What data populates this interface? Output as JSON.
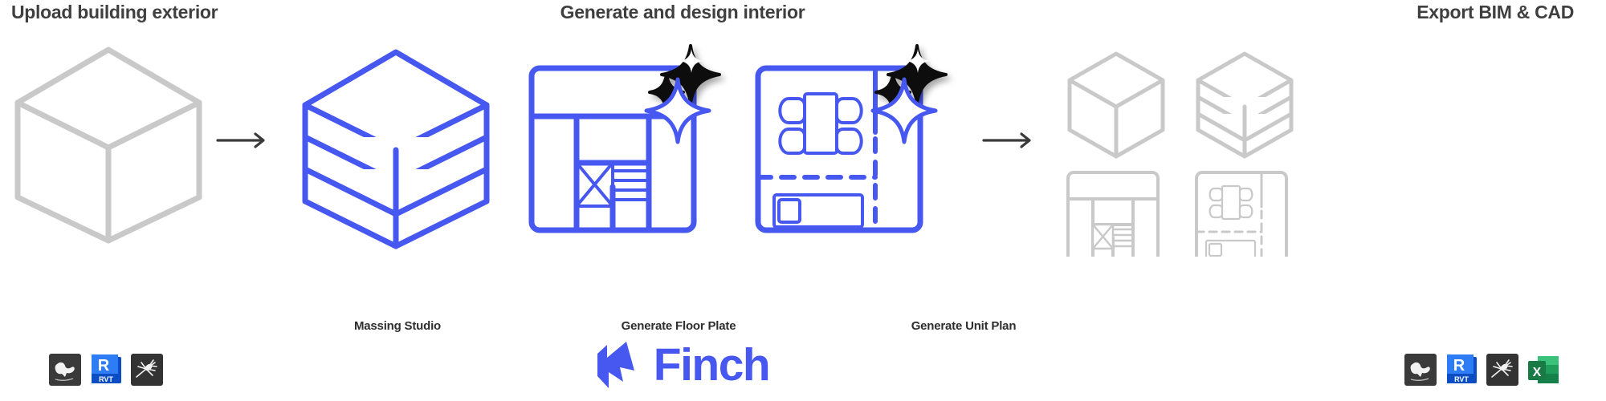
{
  "sections": {
    "upload": {
      "title": "Upload building exterior"
    },
    "generate": {
      "title": "Generate and design interior"
    },
    "export": {
      "title": "Export BIM & CAD"
    }
  },
  "steps": [
    {
      "id": "massing",
      "label": "Massing Studio"
    },
    {
      "id": "floor_plate",
      "label": "Generate Floor Plate"
    },
    {
      "id": "unit_plan",
      "label": "Generate Unit Plan"
    }
  ],
  "brand": {
    "name": "Finch",
    "logo_mark": "finch-bird-mark-icon",
    "accent_color": "#4758f0",
    "outline_gray": "#c9c9c9",
    "title_color": "#3f3f3f"
  },
  "arrows": [
    {
      "id": "arrow-upload-to-generate",
      "icon": "arrow-right-icon"
    },
    {
      "id": "arrow-generate-to-export",
      "icon": "arrow-right-icon"
    }
  ],
  "artwork": {
    "cube_exterior": {
      "icon": "isometric-cube-icon",
      "style": "gray-outline"
    },
    "massing_cube": {
      "icon": "isometric-layered-massing-cube-icon",
      "style": "blue-outline",
      "floors": 3
    },
    "floor_plate": {
      "icon": "floor-plate-plan-icon",
      "style": "blue-outline",
      "has_ai_sparkle": true
    },
    "unit_plan": {
      "icon": "unit-plan-furniture-icon",
      "style": "blue-outline",
      "has_ai_sparkle": true
    },
    "ai_sparkle": {
      "icon": "ai-sparkle-icon"
    },
    "export_thumbnails": [
      {
        "icon": "isometric-cube-icon"
      },
      {
        "icon": "isometric-layered-massing-cube-icon"
      },
      {
        "icon": "floor-plate-plan-icon"
      },
      {
        "icon": "unit-plan-furniture-icon"
      }
    ]
  },
  "software_icons": {
    "input": [
      {
        "id": "rhino",
        "icon": "rhino-icon",
        "label": ""
      },
      {
        "id": "revit",
        "icon": "revit-icon",
        "label": "RVT"
      },
      {
        "id": "grasshopper",
        "icon": "grasshopper-icon",
        "label": ""
      }
    ],
    "output": [
      {
        "id": "rhino",
        "icon": "rhino-icon",
        "label": ""
      },
      {
        "id": "revit",
        "icon": "revit-icon",
        "label": "RVT"
      },
      {
        "id": "grasshopper",
        "icon": "grasshopper-icon",
        "label": ""
      },
      {
        "id": "excel",
        "icon": "excel-icon",
        "label": "X"
      }
    ]
  }
}
